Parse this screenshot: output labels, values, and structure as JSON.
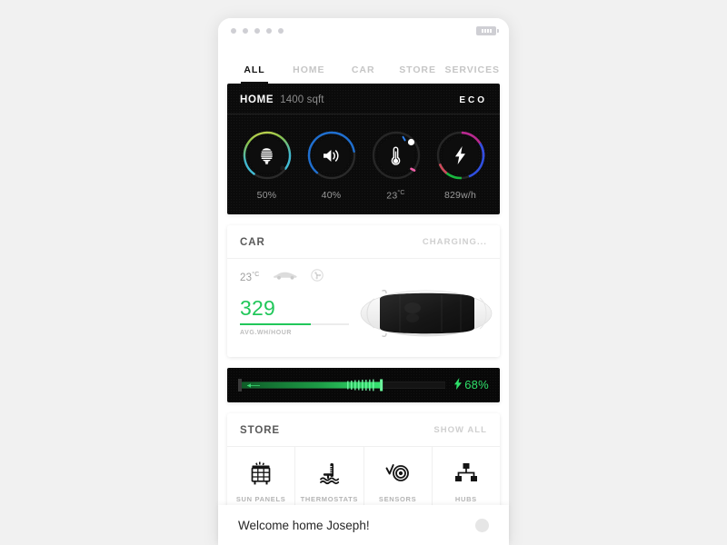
{
  "statusbar": {
    "dots_count": 5,
    "battery_icon": "battery-icon"
  },
  "tabs": [
    {
      "label": "ALL",
      "active": true
    },
    {
      "label": "HOME",
      "active": false
    },
    {
      "label": "CAR",
      "active": false
    },
    {
      "label": "STORE",
      "active": false
    },
    {
      "label": "SERVICES",
      "active": false
    }
  ],
  "home_card": {
    "title": "HOME",
    "subtitle": "1400 sqft",
    "mode": "ECO",
    "dials": [
      {
        "icon": "lightbulb-icon",
        "value": "50%",
        "percent": 50,
        "arc_color": "#4fc3dc"
      },
      {
        "icon": "speaker-icon",
        "value": "40%",
        "percent": 40,
        "arc_color": "#1f6fd0"
      },
      {
        "icon": "thermometer-icon",
        "value": "23",
        "unit": "°C",
        "percent": 62,
        "arc_color": "#ffffff"
      },
      {
        "icon": "bolt-icon",
        "value": "829w/h",
        "percent": 85,
        "arc_color": "#c02fc0"
      }
    ]
  },
  "car_card": {
    "title": "CAR",
    "status": "CHARGING...",
    "temperature": "23",
    "temperature_unit": "°C",
    "icons": [
      "car-side-icon",
      "fan-icon"
    ],
    "energy_value": "329",
    "energy_label": "AVG.WH/HOUR",
    "energy_percent": 65,
    "energy_color": "#21c75a",
    "vehicle_image": "tesla-top-view"
  },
  "charge_bar": {
    "percent": 68,
    "percent_label": "68%",
    "bolt_icon": "bolt-icon",
    "color": "#2ee06a"
  },
  "store_card": {
    "title": "STORE",
    "action": "SHOW ALL",
    "items": [
      {
        "label": "SUN PANELS",
        "icon": "solar-panel-icon"
      },
      {
        "label": "THERMOSTATS",
        "icon": "thermostat-water-icon"
      },
      {
        "label": "SENSORS",
        "icon": "motion-sensor-icon"
      },
      {
        "label": "HUBS",
        "icon": "network-hub-icon"
      }
    ]
  },
  "welcome_bar": {
    "message": "Welcome home Joseph!",
    "avatar": "user-avatar"
  }
}
